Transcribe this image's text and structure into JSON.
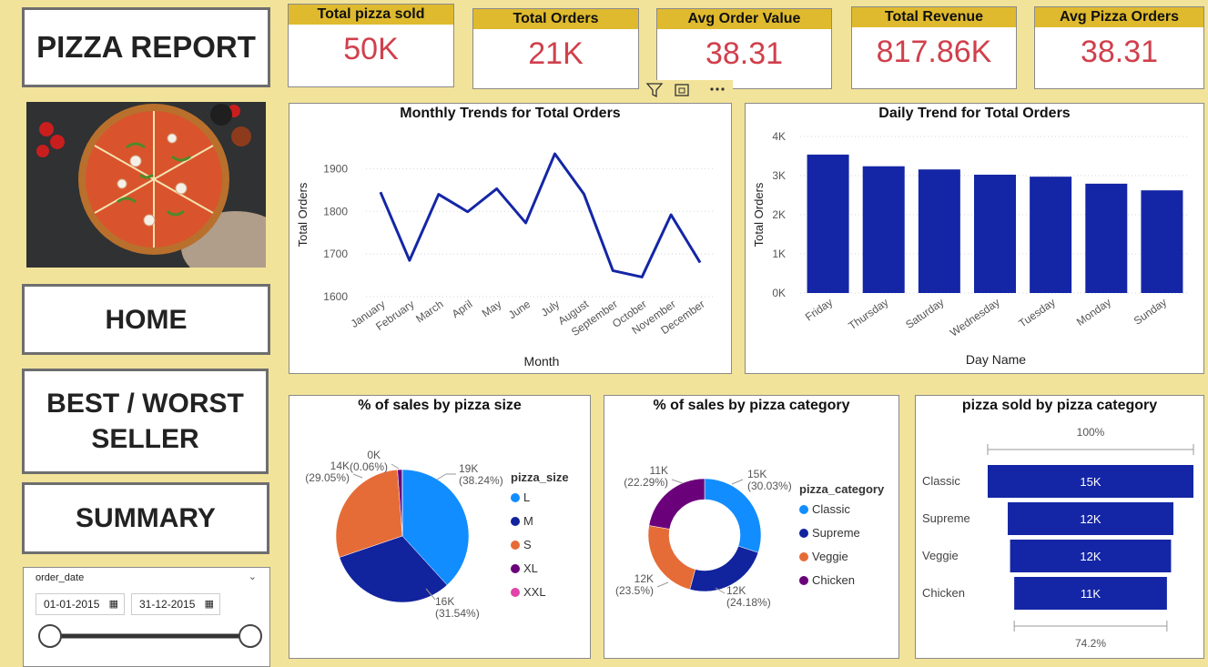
{
  "title": "PIZZA REPORT",
  "nav": {
    "home": "HOME",
    "best_worst": "BEST / WORST\nSELLER",
    "summary": "SUMMARY"
  },
  "kpis": [
    {
      "label": "Total pizza sold",
      "value": "50K"
    },
    {
      "label": "Total Orders",
      "value": "21K"
    },
    {
      "label": "Avg Order Value",
      "value": "38.31"
    },
    {
      "label": "Total Revenue",
      "value": "817.86K"
    },
    {
      "label": "Avg Pizza Orders",
      "value": "38.31"
    }
  ],
  "slicer": {
    "label": "order_date",
    "start": "01-01-2015",
    "end": "31-12-2015",
    "range_fraction": [
      0,
      1
    ]
  },
  "colors": {
    "accent": "#dfba2e",
    "kpi_value": "#d0404d",
    "bar": "#1426a6",
    "background": "#f2e39a"
  },
  "chart_data": [
    {
      "type": "line",
      "title": "Monthly Trends for Total Orders",
      "xlabel": "Month",
      "ylabel": "Total Orders",
      "ylim": [
        1600,
        1950
      ],
      "yticks": [
        "1600",
        "1700",
        "1800",
        "1900"
      ],
      "categories": [
        "January",
        "February",
        "March",
        "April",
        "May",
        "June",
        "July",
        "August",
        "September",
        "October",
        "November",
        "December"
      ],
      "values": [
        1845,
        1685,
        1840,
        1799,
        1853,
        1773,
        1935,
        1841,
        1661,
        1646,
        1792,
        1680
      ]
    },
    {
      "type": "bar",
      "title": "Daily Trend for Total Orders",
      "xlabel": "Day Name",
      "ylabel": "Total Orders",
      "ylim": [
        0,
        4000
      ],
      "yticks": [
        "0K",
        "1K",
        "2K",
        "3K",
        "4K"
      ],
      "categories": [
        "Friday",
        "Thursday",
        "Saturday",
        "Wednesday",
        "Tuesday",
        "Monday",
        "Sunday"
      ],
      "values": [
        3538,
        3239,
        3158,
        3024,
        2973,
        2794,
        2624
      ]
    },
    {
      "type": "pie",
      "title": "% of sales by pizza size",
      "legend_title": "pizza_size",
      "labels": [
        "L",
        "M",
        "S",
        "XL",
        "XXL"
      ],
      "colors": [
        "#118dff",
        "#12239e",
        "#e66c37",
        "#6b007b",
        "#e044a7"
      ],
      "percents": [
        38.24,
        31.54,
        29.05,
        1.11,
        0.06
      ],
      "data_labels": [
        {
          "value": "19K",
          "pct": "(38.24%)"
        },
        {
          "value": "16K",
          "pct": "(31.54%)"
        },
        {
          "value": "14K",
          "pct": "(29.05%)"
        },
        {
          "value": "",
          "pct": ""
        },
        {
          "value": "0K",
          "pct": "(0.06%)"
        }
      ]
    },
    {
      "type": "donut",
      "title": "% of sales by pizza category",
      "legend_title": "pizza_category",
      "labels": [
        "Classic",
        "Supreme",
        "Veggie",
        "Chicken"
      ],
      "colors": [
        "#118dff",
        "#12239e",
        "#e66c37",
        "#6b007b"
      ],
      "percents": [
        30.03,
        24.18,
        23.5,
        22.29
      ],
      "data_labels": [
        {
          "value": "15K",
          "pct": "(30.03%)"
        },
        {
          "value": "12K",
          "pct": "(24.18%)"
        },
        {
          "value": "12K",
          "pct": "(23.5%)"
        },
        {
          "value": "11K",
          "pct": "(22.29%)"
        }
      ]
    },
    {
      "type": "funnel",
      "title": "pizza sold by pizza category",
      "top_pct": "100%",
      "bottom_pct": "74.2%",
      "categories": [
        "Classic",
        "Supreme",
        "Veggie",
        "Chicken"
      ],
      "values": [
        14888,
        11987,
        11649,
        11050
      ],
      "labels": [
        "15K",
        "12K",
        "12K",
        "11K"
      ]
    }
  ]
}
